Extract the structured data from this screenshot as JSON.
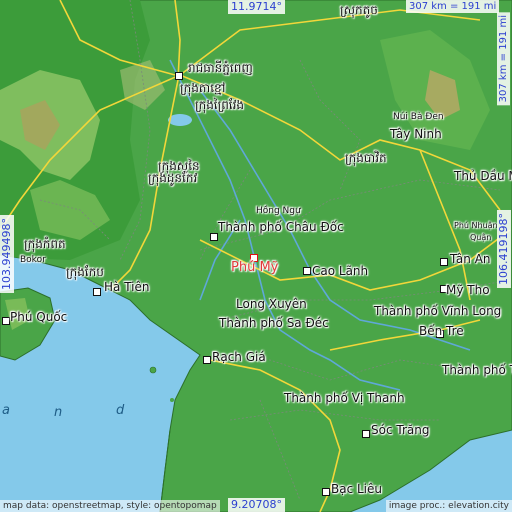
{
  "coords": {
    "top": "11.9714°",
    "bottom": "9.20708°",
    "left": "103.949498°",
    "right": "106.419198°"
  },
  "scales": {
    "horizontal": "307 km = 191 mi",
    "vertical": "307 km = 191 mi"
  },
  "footer": {
    "left": "map data: openstreetmap, style: opentopomap",
    "right": "image proc.: elevation.city"
  },
  "places": {
    "highlight": "Phú Mỹ",
    "chau_doc": "Thành phố Châu Đốc",
    "hong_ngu": "Hồng Ngự",
    "cao_lanh": "Cao Lãnh",
    "long_xuyen": "Long Xuyên",
    "sa_dec": "Thành phố Sa Đéc",
    "rach_gia": "Rạch Giá",
    "ha_tien": "Hà Tiên",
    "phu_quoc": "Phú Quốc",
    "vi_thanh": "Thành phố Vị Thanh",
    "soc_trang": "Sóc Trăng",
    "bac_lieu": "Bạc Liêu",
    "my_tho": "Mỹ Tho",
    "vinh_long": "Thành phố Vĩnh Long",
    "ben_tre": "Bến Tre",
    "tra_vinh": "Thành phố Trà",
    "tan_an": "Tân An",
    "tay_ninh": "Tây Ninh",
    "nui_ba_den": "Núi Bà Đen",
    "thu_dau_mot": "Thủ Dầu M",
    "phu_nhuan": "Phú Nhuận",
    "quan": "Quận",
    "bokor": "Bokor",
    "kh_top": "ស្រុកតូច",
    "kh_phnom": "រាជធានីភ្នំពេញ",
    "kh_1": "ក្រុងតាខ្មៅ",
    "kh_2": "ក្រុងសូនៃ",
    "kh_3": "ក្រុងបាវិត",
    "kh_4": "ក្រុងដូនកែវ",
    "kh_5": "ក្រុងកំពត",
    "kh_6": "ក្រុងកែប",
    "kh_7": "ក្រុងព្រៃវែង"
  },
  "sea_letters": [
    "a",
    "n",
    "d"
  ]
}
